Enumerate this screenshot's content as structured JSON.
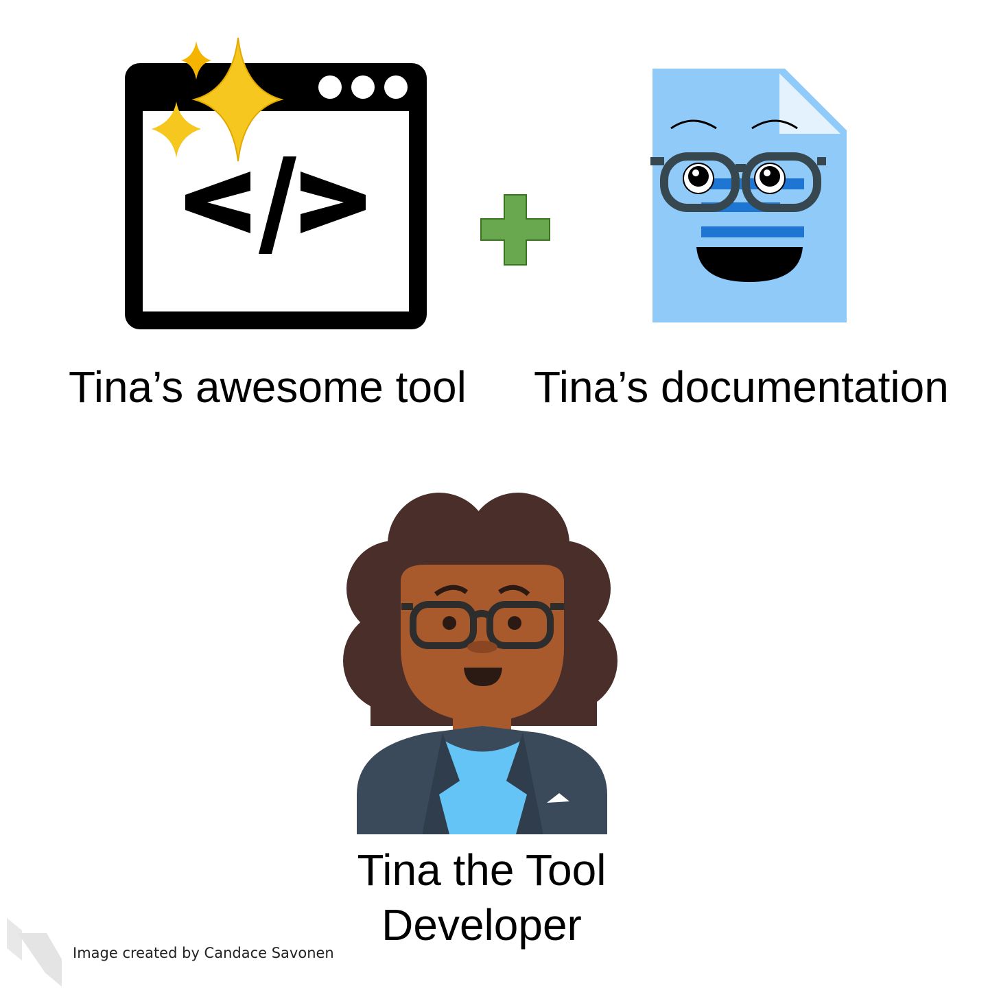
{
  "tool": {
    "caption": "Tina’s awesome tool",
    "code_glyph": "</>",
    "icon": "code-window-icon"
  },
  "connector": {
    "icon": "plus-icon",
    "color": "#6aa84f"
  },
  "docs": {
    "caption": "Tina’s documentation",
    "icon": "document-face-icon",
    "color": "#90caf9"
  },
  "developer": {
    "caption_line1": "Tina the Tool",
    "caption_line2": "Developer",
    "icon": "developer-avatar-icon"
  },
  "credit": "Image created by Candace Savonen",
  "colors": {
    "sparkle": "#f6c71e",
    "hair": "#4a2e2a",
    "skin": "#a95a2d",
    "jacket": "#3b4a5a",
    "shirt": "#64c4f5"
  }
}
